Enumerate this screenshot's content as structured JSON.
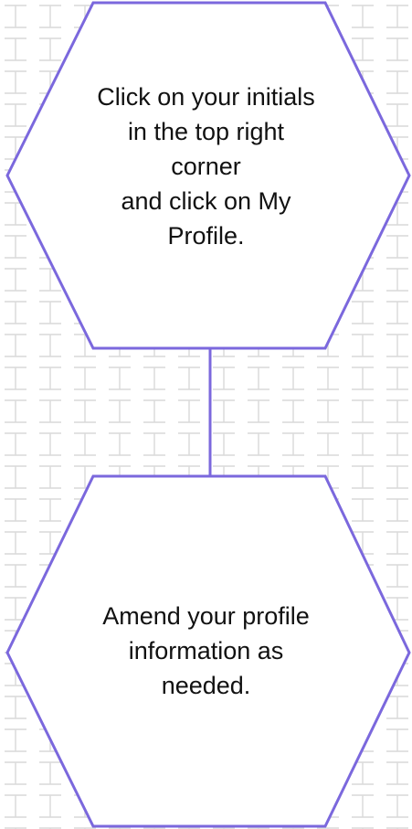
{
  "colors": {
    "hex_stroke": "#7b68dd",
    "connector": "#7b68dd",
    "hex_fill": "#ffffff",
    "pattern": "#d9d9d9",
    "text": "#111111"
  },
  "steps": [
    {
      "shape": "hexagon",
      "lines": [
        "Click on your initials",
        "in the top right",
        "corner",
        "and click on My",
        "Profile."
      ]
    },
    {
      "shape": "hexagon",
      "lines": [
        "Amend your profile",
        "information as",
        "needed."
      ]
    }
  ],
  "connectors": [
    {
      "from": "step-1",
      "to": "step-2",
      "style": "solid-line"
    }
  ]
}
